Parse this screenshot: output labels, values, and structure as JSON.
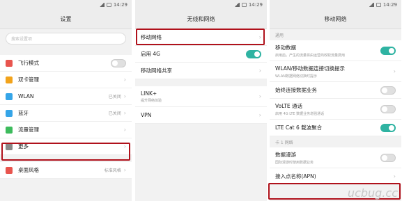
{
  "status": {
    "time": "14:29"
  },
  "p1": {
    "title": "设置",
    "search_placeholder": "搜索设置项",
    "items": [
      {
        "label": "飞行模式",
        "val": "",
        "color": "#e8554e"
      },
      {
        "label": "双卡管理",
        "val": "",
        "color": "#f2a31b"
      },
      {
        "label": "WLAN",
        "val": "已关闭",
        "color": "#35a5e8"
      },
      {
        "label": "蓝牙",
        "val": "已关闭",
        "color": "#35a5e8"
      },
      {
        "label": "流量管理",
        "val": "",
        "color": "#3dbb5c"
      },
      {
        "label": "更多",
        "val": "",
        "color": "#888"
      }
    ],
    "items2": [
      {
        "label": "桌面风格",
        "val": "标准风格",
        "color": "#e8554e"
      }
    ]
  },
  "p2": {
    "title": "无线和网络",
    "r1": "移动网络",
    "r2": "启用 4G",
    "r3": "移动网络共享",
    "r4": "LINK+",
    "r4sub": "提升网络体验",
    "r5": "VPN"
  },
  "p3": {
    "title": "移动网络",
    "sec1": "通用",
    "rows": [
      {
        "label": "移动数据",
        "sub": "启用后，产生的流量将由运营商收取流量费用",
        "tog": "on"
      },
      {
        "label": "WLAN/移动数据连接切换提示",
        "sub": "WLAN数据网络切换时提示",
        "tog": "chev"
      },
      {
        "label": "始终连接数据业务",
        "sub": "",
        "tog": "off"
      },
      {
        "label": "VoLTE 通话",
        "sub": "启用 4G LTE 数据业务增强通话",
        "tog": "off"
      },
      {
        "label": "LTE Cat 6 载波聚合",
        "sub": "",
        "tog": "on"
      }
    ],
    "sec2": "卡 1 网络",
    "r6": "数据漫游",
    "r6sub": "国际漫游时使用数据业务",
    "r7": "接入点名称(APN)"
  },
  "watermark": "ucbug.cc"
}
